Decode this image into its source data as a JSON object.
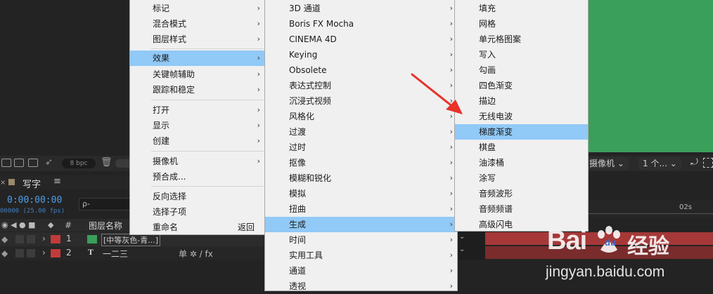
{
  "toolbar": {
    "bpc_label": "8 bpc",
    "camera_label": "摄像机",
    "views_label": "1 个..."
  },
  "timeline": {
    "tab_label": "写字",
    "timecode": "0:00:00:00",
    "fps": "00000 (25.00 fps)",
    "search_placeholder": "ρ-",
    "col_number": "#",
    "col_name": "图层名称",
    "ruler_label": "02s",
    "layers": [
      {
        "num": "1",
        "name": "[中等灰色-青...]",
        "color": "#3a9f5a",
        "switches": "单 / fx"
      },
      {
        "num": "2",
        "name": "一二三",
        "type_icon": "T",
        "color": "#c23b3b",
        "switches": "单 ✲ / fx"
      }
    ]
  },
  "menu_main": {
    "items": [
      {
        "label": "标记",
        "submenu": true
      },
      {
        "label": "混合模式",
        "submenu": true
      },
      {
        "label": "图层样式",
        "submenu": true
      },
      {
        "label": "效果",
        "submenu": true,
        "highlighted": true
      },
      {
        "label": "关键帧辅助",
        "submenu": true
      },
      {
        "label": "跟踪和稳定",
        "submenu": true
      },
      {
        "label": "打开",
        "submenu": true
      },
      {
        "label": "显示",
        "submenu": true
      },
      {
        "label": "创建",
        "submenu": true
      },
      {
        "label": "摄像机",
        "submenu": true
      },
      {
        "label": "预合成..."
      },
      {
        "label": "反向选择"
      },
      {
        "label": "选择子项"
      },
      {
        "label": "重命名",
        "shortcut": "返回"
      }
    ]
  },
  "menu_effects": {
    "items": [
      {
        "label": "3D 通道"
      },
      {
        "label": "Boris FX Mocha"
      },
      {
        "label": "CINEMA 4D"
      },
      {
        "label": "Keying"
      },
      {
        "label": "Obsolete"
      },
      {
        "label": "表达式控制"
      },
      {
        "label": "沉浸式视频"
      },
      {
        "label": "风格化"
      },
      {
        "label": "过渡"
      },
      {
        "label": "过时"
      },
      {
        "label": "抠像"
      },
      {
        "label": "模糊和锐化"
      },
      {
        "label": "模拟"
      },
      {
        "label": "扭曲"
      },
      {
        "label": "生成",
        "highlighted": true
      },
      {
        "label": "时间"
      },
      {
        "label": "实用工具"
      },
      {
        "label": "通道"
      },
      {
        "label": "透视"
      }
    ]
  },
  "menu_generate": {
    "items": [
      {
        "label": "填充"
      },
      {
        "label": "网格"
      },
      {
        "label": "单元格图案"
      },
      {
        "label": "写入"
      },
      {
        "label": "勾画"
      },
      {
        "label": "四色渐变"
      },
      {
        "label": "描边"
      },
      {
        "label": "无线电波"
      },
      {
        "label": "梯度渐变",
        "highlighted": true
      },
      {
        "label": "棋盘"
      },
      {
        "label": "油漆桶"
      },
      {
        "label": "涂写"
      },
      {
        "label": "音频波形"
      },
      {
        "label": "音频频谱"
      },
      {
        "label": "高级闪电"
      }
    ]
  },
  "watermark": {
    "brand": "Bai",
    "paw": "du",
    "cn": "经验",
    "url": "jingyan.baidu.com"
  },
  "colors": {
    "highlight": "#91c9f7",
    "menu_bg": "#f0f0f0",
    "annotation_arrow": "#e8322a",
    "preview_green": "#3a9f5a"
  }
}
